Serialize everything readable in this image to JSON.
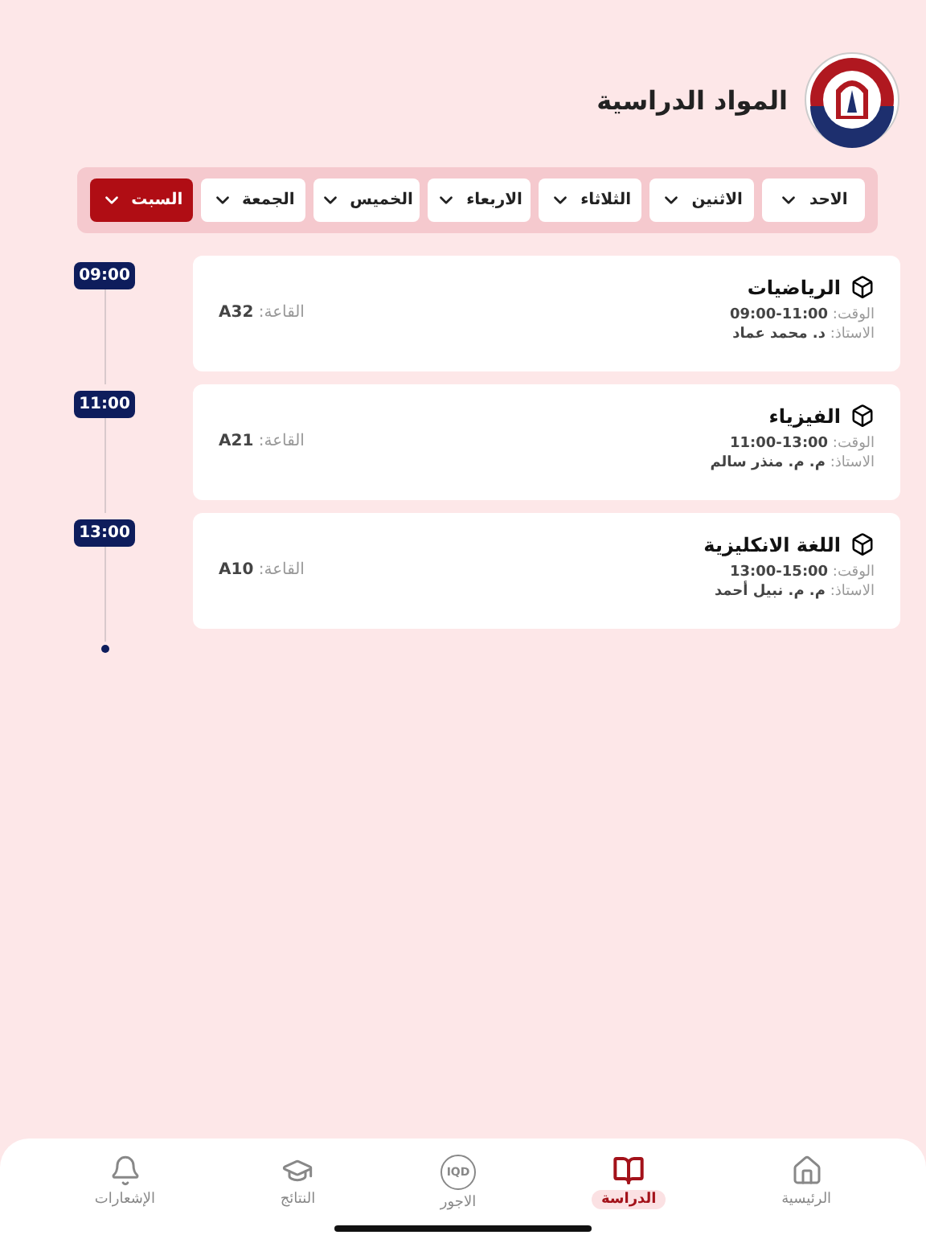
{
  "header": {
    "title": "المواد الدراسية"
  },
  "days": [
    {
      "label": "الاحد",
      "selected": false
    },
    {
      "label": "الاثنين",
      "selected": false
    },
    {
      "label": "الثلاثاء",
      "selected": false
    },
    {
      "label": "الاربعاء",
      "selected": false
    },
    {
      "label": "الخميس",
      "selected": false
    },
    {
      "label": "الجمعة",
      "selected": false
    },
    {
      "label": "السبت",
      "selected": true
    }
  ],
  "schedule": [
    {
      "time": "09:00",
      "subject": "الرياضيات",
      "time_line": "الوقت: **09:00-11:00**",
      "teacher_line": "الاستاذ: **د. محمد عماد**",
      "room_line": "القاعة: **A32**"
    },
    {
      "time": "11:00",
      "subject": "الفيزياء",
      "time_line": "الوقت: **11:00-13:00**",
      "teacher_line": "الاستاذ: **م. م. منذر سالم**",
      "room_line": "القاعة: **A21**"
    },
    {
      "time": "13:00",
      "subject": "اللغة الانكليزية",
      "time_line": "الوقت: **13:00-15:00**",
      "teacher_line": "الاستاذ: **م. م. نبيل أحمد**",
      "room_line": "القاعة: **A10**"
    }
  ],
  "nav": [
    {
      "kind": "home",
      "label": "الرئيسية",
      "selected": false
    },
    {
      "kind": "book",
      "label": "الدراسة",
      "selected": true
    },
    {
      "kind": "currency",
      "label": "الاجور",
      "icon_text": "IQD",
      "selected": false
    },
    {
      "kind": "cap",
      "label": "النتائج",
      "selected": false
    },
    {
      "kind": "bell",
      "label": "الإشعارات",
      "selected": false
    }
  ]
}
